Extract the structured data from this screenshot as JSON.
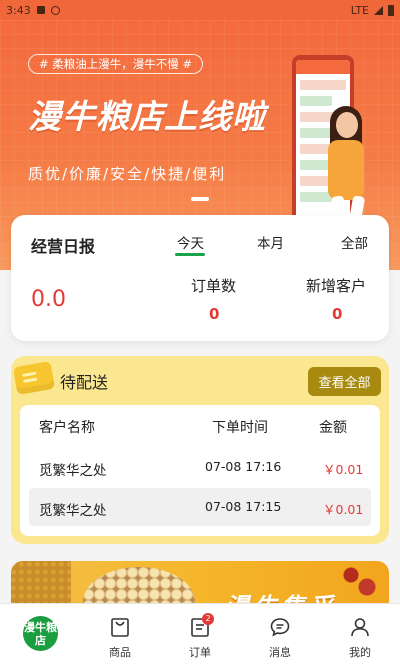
{
  "status_bar": {
    "time": "3:43",
    "network": "LTE"
  },
  "banner": {
    "slogan": "# 柔粮油上漫牛，漫牛不慢 #",
    "headline": "漫牛粮店上线啦",
    "features": "质优/价廉/安全/快捷/便利"
  },
  "stats": {
    "title": "经营日报",
    "tabs": [
      "今天",
      "本月",
      "全部"
    ],
    "active_tab": "今天",
    "revenue": "0.0",
    "metrics": [
      {
        "label": "订单数",
        "value": "0"
      },
      {
        "label": "新增客户",
        "value": "0"
      }
    ]
  },
  "pending": {
    "title": "待配送",
    "view_all_label": "查看全部",
    "columns": [
      "客户名称",
      "下单时间",
      "金额"
    ],
    "orders": [
      {
        "customer": "觅繁华之处",
        "time": "07-08 17:16",
        "amount": "￥0.01"
      },
      {
        "customer": "觅繁华之处",
        "time": "07-08 17:15",
        "amount": "￥0.01"
      }
    ]
  },
  "promo": {
    "text": "漫牛集采"
  },
  "bottom_nav": {
    "home_logo": "漫牛粮店",
    "items": [
      {
        "label": "商品",
        "icon": "bag-icon"
      },
      {
        "label": "订单",
        "icon": "order-icon",
        "badge": "2"
      },
      {
        "label": "消息",
        "icon": "message-icon"
      },
      {
        "label": "我的",
        "icon": "user-icon"
      }
    ]
  },
  "colors": {
    "brand_orange": "#f46a3d",
    "brand_green": "#1aa34a",
    "amount_red": "#e53935",
    "pending_yellow": "#fbe78f",
    "view_all_gold": "#a88a10"
  }
}
